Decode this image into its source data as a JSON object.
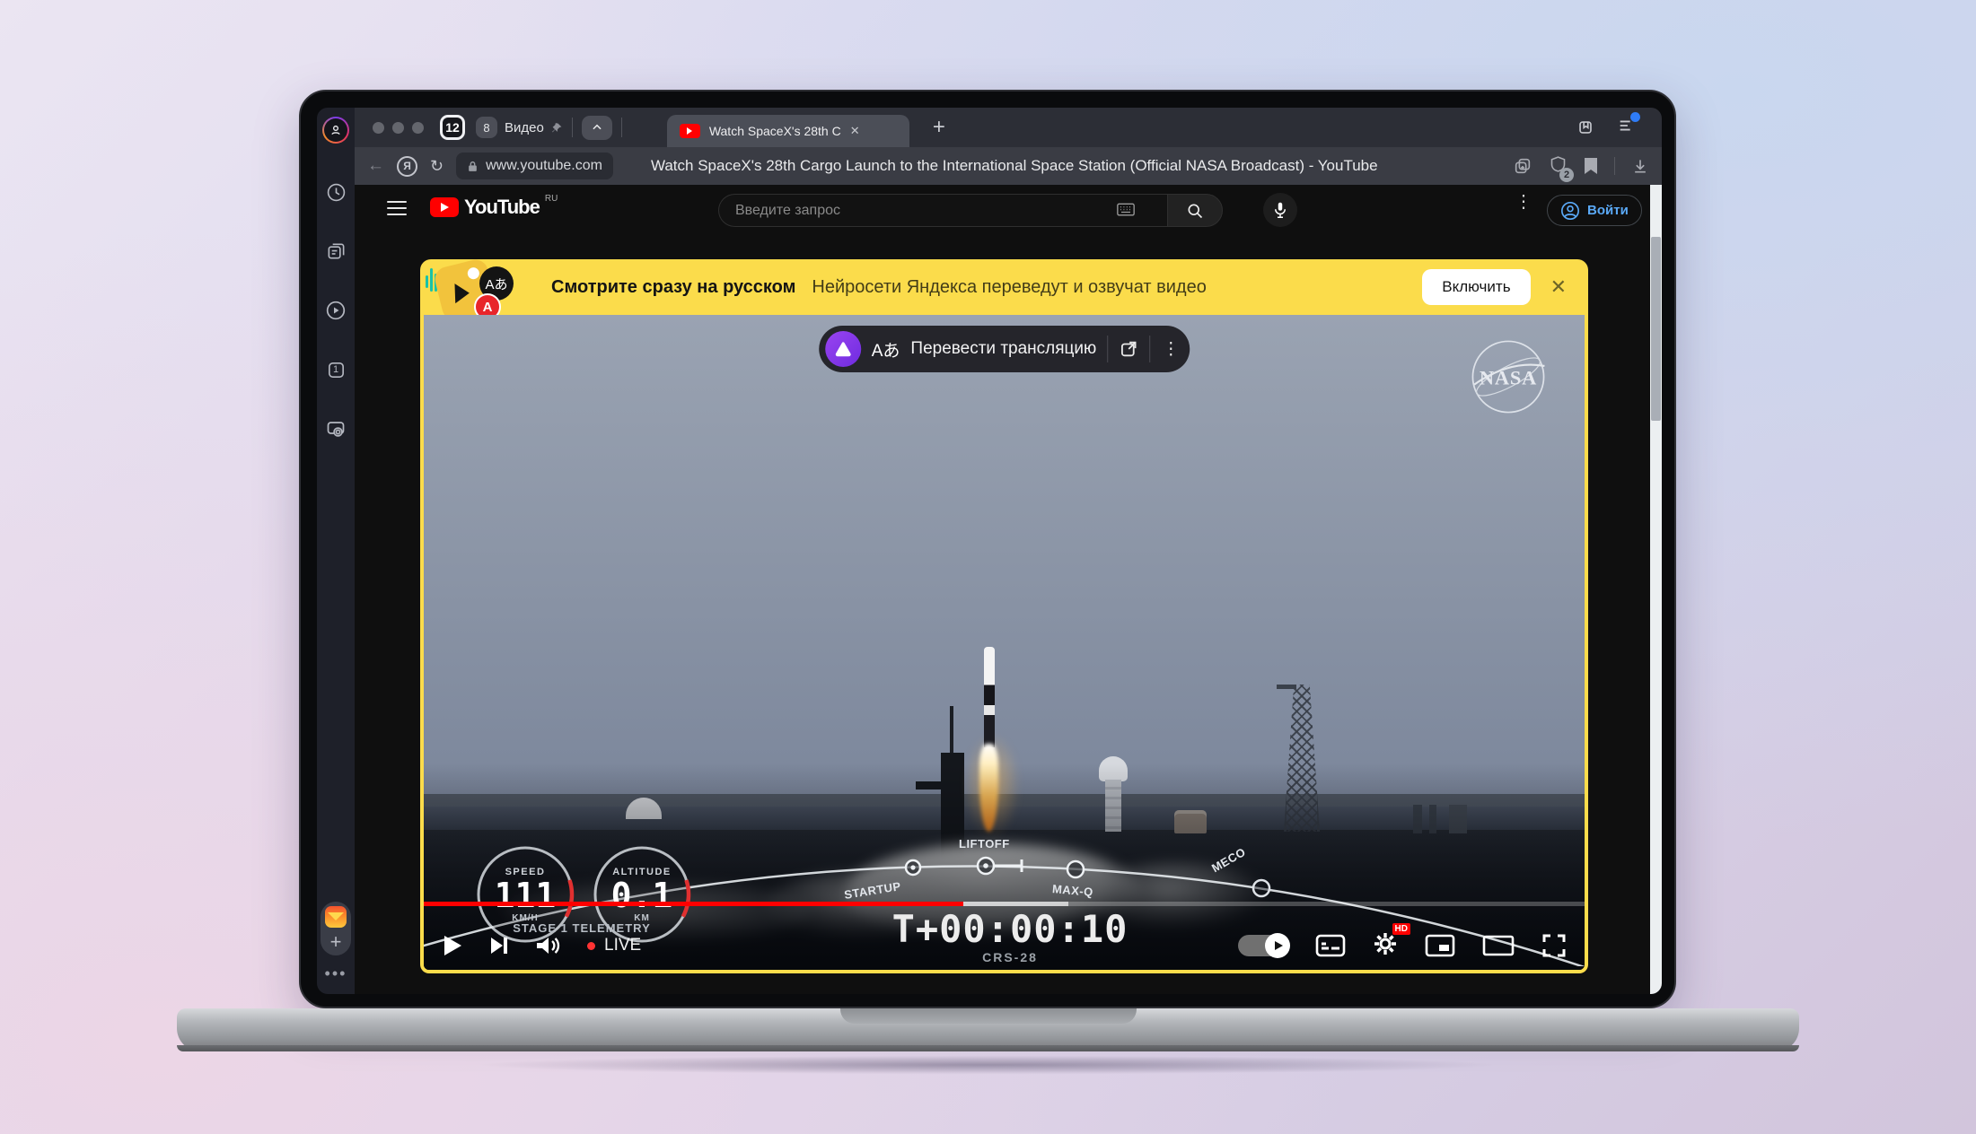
{
  "browser": {
    "tab_bar": {
      "tab_count": "12",
      "pinned_count": "8",
      "pinned_label": "Видео",
      "active_tab_title": "Watch SpaceX's 28th C",
      "close_glyph": "✕",
      "new_tab_glyph": "+"
    },
    "address_bar": {
      "back_glyph": "←",
      "yandex_glyph": "Я",
      "reload_glyph": "↻",
      "url": "www.youtube.com",
      "page_title": "Watch SpaceX's 28th Cargo Launch to the International Space Station (Official NASA Broadcast) - YouTube",
      "shield_count": "2"
    }
  },
  "sidebar": {
    "tab_square_label": "1",
    "plus_glyph": "+",
    "dots_glyph": "•••"
  },
  "youtube": {
    "header": {
      "logo_text": "YouTube",
      "region": "RU",
      "search_placeholder": "Введите запрос",
      "menu_glyph": "⋮",
      "sign_in_label": "Войти"
    },
    "banner": {
      "badge_glyph": "Aあ",
      "badge_letter": "A",
      "title": "Смотрите сразу на русском",
      "subtitle": "Нейросети Яндекса переведут и озвучат видео",
      "enable_label": "Включить",
      "close_glyph": "✕"
    },
    "player": {
      "translate_glyph": "Aあ",
      "translate_label": "Перевести трансляцию",
      "menu_glyph": "⋮",
      "nasa_text": "NASA",
      "speed_label": "SPEED",
      "speed_value": "111",
      "speed_unit": "KM/H",
      "altitude_label": "ALTITUDE",
      "altitude_value": "0.1",
      "altitude_unit": "KM",
      "stage_label": "STAGE 1 TELEMETRY",
      "nodes": {
        "startup": "STARTUP",
        "liftoff": "LIFTOFF",
        "maxq": "MAX-Q",
        "meco": "MECO"
      },
      "mission_time": "T+00:00:10",
      "mission_name": "CRS-28",
      "live_label": "LIVE",
      "hd_badge": "HD"
    }
  }
}
